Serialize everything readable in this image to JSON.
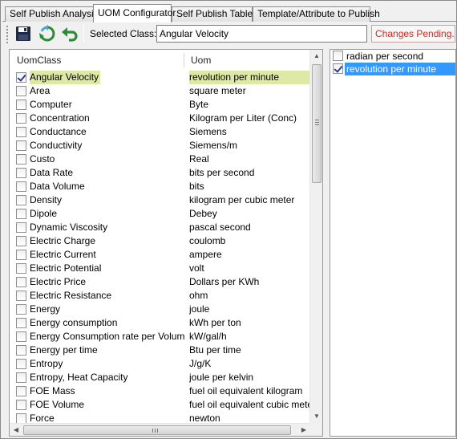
{
  "tabs": [
    {
      "label": "Self Publish Analysis",
      "active": false
    },
    {
      "label": "UOM Configurator",
      "active": true
    },
    {
      "label": "Self Publish Tables",
      "active": false
    },
    {
      "label": "Template/Attribute to Publish",
      "active": false
    }
  ],
  "toolbar": {
    "save_icon": "save-disk-icon",
    "refresh_icon": "refresh-icon",
    "undo_icon": "undo-arrow-icon",
    "selected_class_label": "Selected Class:",
    "selected_class_value": "Angular Velocity",
    "pending_label": "Changes Pending..."
  },
  "grid": {
    "columns": [
      "UomClass",
      "Uom"
    ],
    "rows": [
      {
        "uom_class": "Angular Velocity",
        "uom": "revolution per minute",
        "checked": true,
        "selected": true
      },
      {
        "uom_class": "Area",
        "uom": "square meter",
        "checked": false
      },
      {
        "uom_class": "Computer",
        "uom": "Byte",
        "checked": false
      },
      {
        "uom_class": "Concentration",
        "uom": "Kilogram per Liter (Conc)",
        "checked": false
      },
      {
        "uom_class": "Conductance",
        "uom": "Siemens",
        "checked": false
      },
      {
        "uom_class": "Conductivity",
        "uom": "Siemens/m",
        "checked": false
      },
      {
        "uom_class": "Custo",
        "uom": "Real",
        "checked": false
      },
      {
        "uom_class": "Data Rate",
        "uom": "bits per second",
        "checked": false
      },
      {
        "uom_class": "Data Volume",
        "uom": "bits",
        "checked": false
      },
      {
        "uom_class": "Density",
        "uom": "kilogram per cubic meter",
        "checked": false
      },
      {
        "uom_class": "Dipole",
        "uom": "Debey",
        "checked": false
      },
      {
        "uom_class": "Dynamic Viscosity",
        "uom": "pascal second",
        "checked": false
      },
      {
        "uom_class": "Electric Charge",
        "uom": "coulomb",
        "checked": false
      },
      {
        "uom_class": "Electric Current",
        "uom": "ampere",
        "checked": false
      },
      {
        "uom_class": "Electric Potential",
        "uom": "volt",
        "checked": false
      },
      {
        "uom_class": "Electric Price",
        "uom": "Dollars per KWh",
        "checked": false
      },
      {
        "uom_class": "Electric Resistance",
        "uom": "ohm",
        "checked": false
      },
      {
        "uom_class": "Energy",
        "uom": "joule",
        "checked": false
      },
      {
        "uom_class": "Energy consumption",
        "uom": "kWh per ton",
        "checked": false
      },
      {
        "uom_class": "Energy Consumption rate per Volume",
        "uom": "kW/gal/h",
        "checked": false
      },
      {
        "uom_class": "Energy per time",
        "uom": "Btu per time",
        "checked": false
      },
      {
        "uom_class": "Entropy",
        "uom": "J/g/K",
        "checked": false
      },
      {
        "uom_class": "Entropy, Heat Capacity",
        "uom": "joule per kelvin",
        "checked": false
      },
      {
        "uom_class": "FOE Mass",
        "uom": "fuel oil equivalent kilogram",
        "checked": false
      },
      {
        "uom_class": "FOE Volume",
        "uom": "fuel oil equivalent cubic meter",
        "checked": false
      },
      {
        "uom_class": "Force",
        "uom": "newton",
        "checked": false
      }
    ]
  },
  "uom_list": [
    {
      "label": "radian per second",
      "checked": false,
      "selected": false
    },
    {
      "label": "revolution per minute",
      "checked": true,
      "selected": true
    }
  ],
  "colors": {
    "row_highlight": "#dde9a4",
    "list_selection": "#3399ff",
    "pending_text": "#d02b1e"
  }
}
